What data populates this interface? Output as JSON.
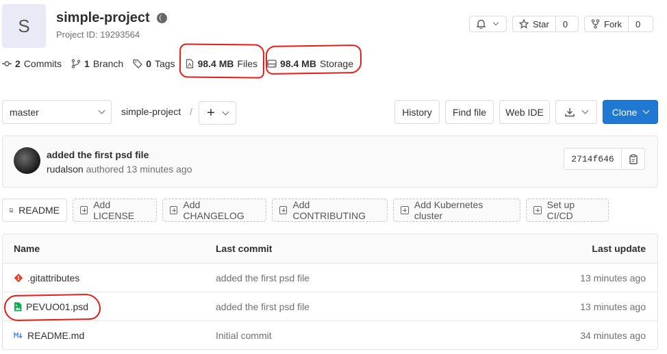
{
  "project": {
    "avatar_letter": "S",
    "name": "simple-project",
    "id_label": "Project ID: 19293564"
  },
  "header_buttons": {
    "star_label": "Star",
    "star_count": "0",
    "fork_label": "Fork",
    "fork_count": "0"
  },
  "stats": {
    "commits_count": "2",
    "commits_label": "Commits",
    "branch_count": "1",
    "branch_label": "Branch",
    "tags_count": "0",
    "tags_label": "Tags",
    "files_size": "98.4 MB",
    "files_label": "Files",
    "storage_size": "98.4 MB",
    "storage_label": "Storage"
  },
  "nav": {
    "branch": "master",
    "breadcrumb": "simple-project",
    "separator": "/",
    "history": "History",
    "find_file": "Find file",
    "web_ide": "Web IDE",
    "clone": "Clone"
  },
  "last_commit": {
    "title": "added the first psd file",
    "author": "rudalson",
    "meta": "authored 13 minutes ago",
    "sha": "2714f646"
  },
  "actions": {
    "readme": "README",
    "add_license": "Add LICENSE",
    "add_changelog": "Add CHANGELOG",
    "add_contributing": "Add CONTRIBUTING",
    "add_kubernetes": "Add Kubernetes cluster",
    "setup_ci": "Set up CI/CD"
  },
  "table": {
    "headers": {
      "name": "Name",
      "last_commit": "Last commit",
      "last_update": "Last update"
    },
    "rows": [
      {
        "name": ".gitattributes",
        "icon": "git-icon",
        "commit": "added the first psd file",
        "updated": "13 minutes ago"
      },
      {
        "name": "PEVUO01.psd",
        "icon": "image-file-icon",
        "commit": "added the first psd file",
        "updated": "13 minutes ago"
      },
      {
        "name": "README.md",
        "icon": "markdown-icon",
        "commit": "Initial commit",
        "updated": "34 minutes ago"
      }
    ]
  },
  "colors": {
    "primary_blue": "#1f78d1",
    "annotation_red": "#e41b17"
  }
}
